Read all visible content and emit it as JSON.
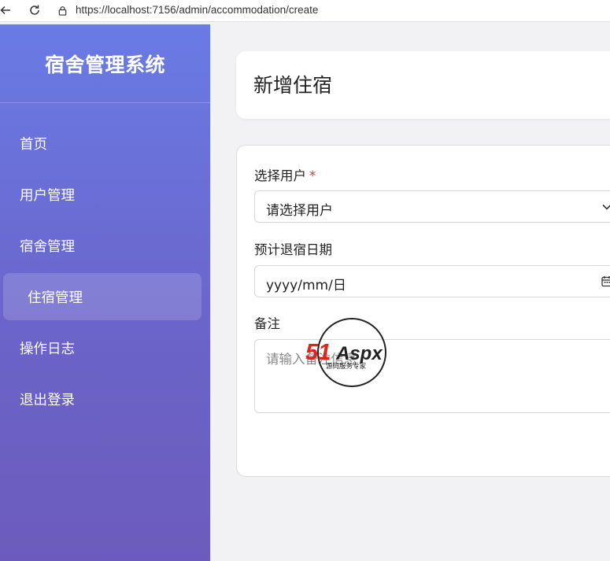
{
  "browser": {
    "url": "https://localhost:7156/admin/accommodation/create"
  },
  "sidebar": {
    "title": "宿舍管理系统",
    "items": [
      {
        "label": "首页",
        "active": false
      },
      {
        "label": "用户管理",
        "active": false
      },
      {
        "label": "宿舍管理",
        "active": false
      },
      {
        "label": "住宿管理",
        "active": true
      },
      {
        "label": "操作日志",
        "active": false
      },
      {
        "label": "退出登录",
        "active": false
      }
    ]
  },
  "page": {
    "title": "新增住宿"
  },
  "form": {
    "user": {
      "label": "选择用户",
      "required_mark": "*",
      "value": "请选择用户"
    },
    "checkout_date": {
      "label": "预计退宿日期",
      "value": "yyyy/mm/日"
    },
    "remark": {
      "label": "备注",
      "placeholder": "请输入备注信息"
    }
  },
  "watermark": {
    "text": "51Aspx",
    "subtitle": "源码服务专家"
  },
  "colors": {
    "sidebar_top": "#6a7be5",
    "sidebar_bottom": "#6c5bbd",
    "required": "#d9342b",
    "watermark_red": "#e2231a",
    "watermark_green": "#3aa335"
  }
}
